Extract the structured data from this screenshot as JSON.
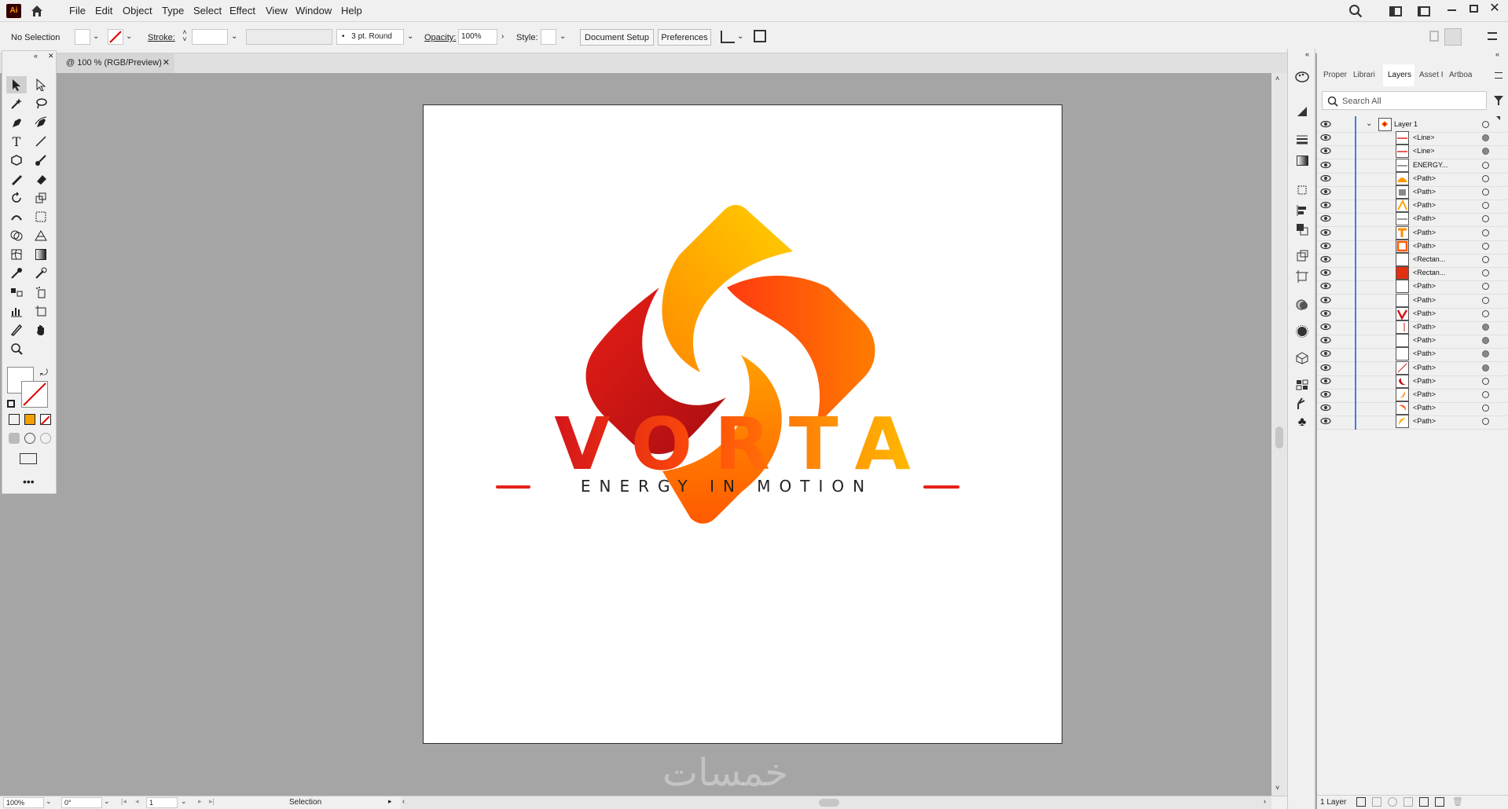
{
  "app": {
    "logo_text": "Ai",
    "menus": [
      "File",
      "Edit",
      "Object",
      "Type",
      "Select",
      "Effect",
      "View",
      "Window",
      "Help"
    ]
  },
  "control": {
    "selection": "No Selection",
    "stroke_label": "Stroke:",
    "brush": "3 pt. Round",
    "opacity_label": "Opacity:",
    "opacity_value": "100%",
    "style_label": "Style:",
    "doc_setup": "Document Setup",
    "preferences": "Preferences"
  },
  "document": {
    "tab_label": "@ 100 % (RGB/Preview)"
  },
  "artwork": {
    "brand": "VORTA",
    "tagline": "ENERGY IN MOTION",
    "watermark": "خمسات"
  },
  "status": {
    "zoom": "100%",
    "rotate": "0°",
    "artboard": "1",
    "tool": "Selection"
  },
  "panel": {
    "tabs": [
      "Proper",
      "Librari",
      "Layers",
      "Asset I",
      "Artboa"
    ],
    "search_placeholder": "Search All",
    "layers": [
      {
        "name": "Layer 1",
        "thumb": "logo",
        "target": false,
        "top": true
      },
      {
        "name": "<Line>",
        "thumb": "line-red",
        "target": true
      },
      {
        "name": "<Line>",
        "thumb": "line-red",
        "target": true
      },
      {
        "name": "ENERGY...",
        "thumb": "line-dark",
        "target": false
      },
      {
        "name": "<Path>",
        "thumb": "orange-hill",
        "target": false
      },
      {
        "name": "<Path>",
        "thumb": "gray-shape",
        "target": false
      },
      {
        "name": "<Path>",
        "thumb": "orange-a",
        "target": false
      },
      {
        "name": "<Path>",
        "thumb": "line-dark",
        "target": false
      },
      {
        "name": "<Path>",
        "thumb": "orange-t",
        "target": false
      },
      {
        "name": "<Path>",
        "thumb": "orange-r",
        "target": false
      },
      {
        "name": "<Rectan...",
        "thumb": "blank",
        "target": false
      },
      {
        "name": "<Rectan...",
        "thumb": "red-fill",
        "target": false
      },
      {
        "name": "<Path>",
        "thumb": "blank",
        "target": false
      },
      {
        "name": "<Path>",
        "thumb": "blank",
        "target": false
      },
      {
        "name": "<Path>",
        "thumb": "red-v",
        "target": false
      },
      {
        "name": "<Path>",
        "thumb": "blank-bar",
        "target": true
      },
      {
        "name": "<Path>",
        "thumb": "blank",
        "target": true
      },
      {
        "name": "<Path>",
        "thumb": "blank",
        "target": true
      },
      {
        "name": "<Path>",
        "thumb": "blank-diag",
        "target": true
      },
      {
        "name": "<Path>",
        "thumb": "red-swirl",
        "target": false
      },
      {
        "name": "<Path>",
        "thumb": "orange-swirl",
        "target": false
      },
      {
        "name": "<Path>",
        "thumb": "orange-swirl2",
        "target": false
      },
      {
        "name": "<Path>",
        "thumb": "yellow-swirl",
        "target": false
      }
    ],
    "footer": "1 Layer"
  },
  "colors": {
    "accent": "#4a78e0",
    "brand_red": "#d4151a",
    "brand_orange": "#ff6a00",
    "brand_yellow": "#ffc400"
  }
}
